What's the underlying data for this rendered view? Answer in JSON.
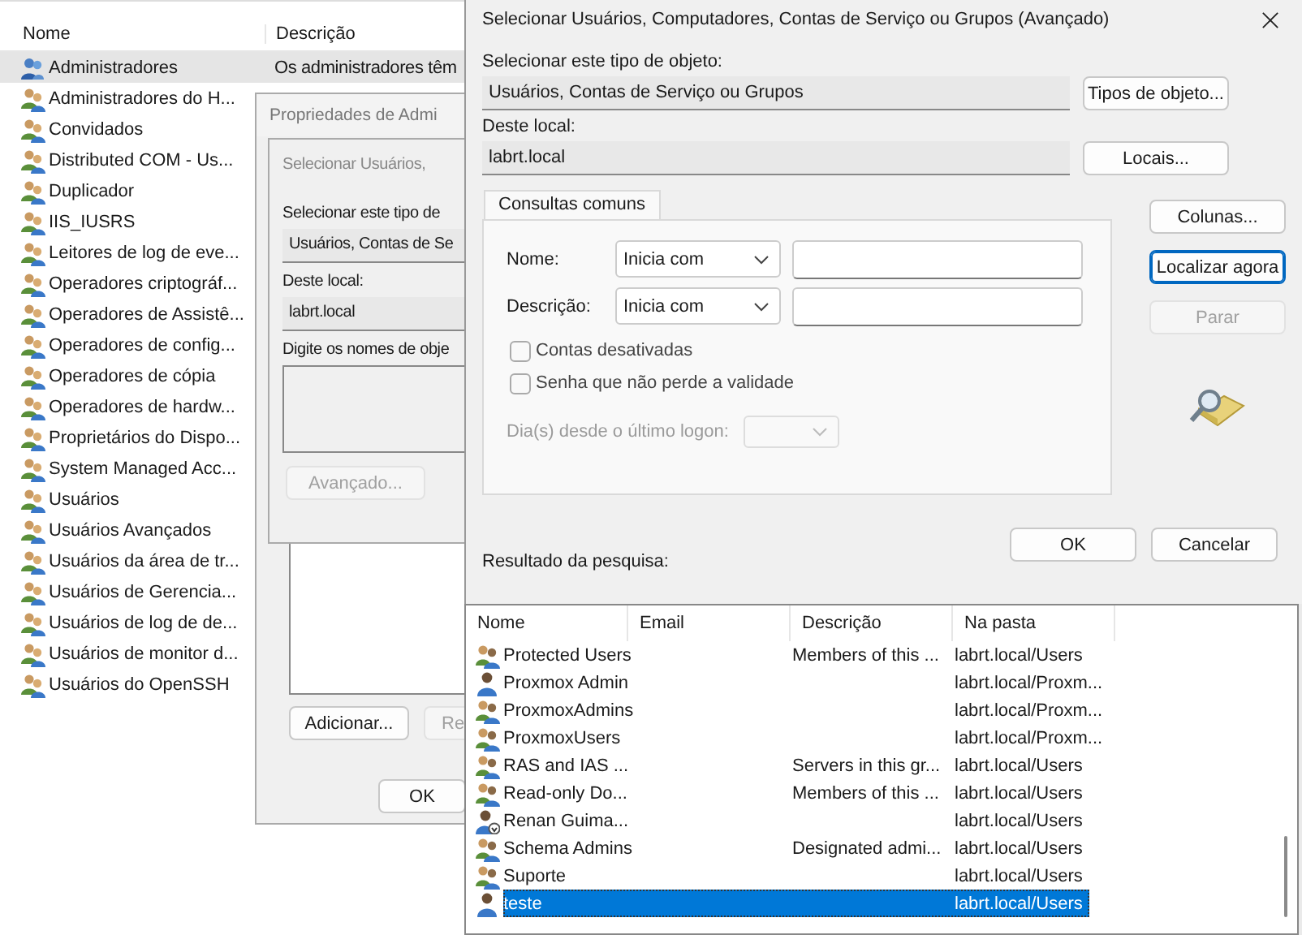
{
  "group_list": {
    "columns": [
      "Nome",
      "Descrição"
    ],
    "rows": [
      {
        "name": "Administradores",
        "description": "Os administradores têm",
        "kind": "special",
        "selected": true
      },
      {
        "name": "Administradores do H...",
        "kind": "group",
        "selected": false
      },
      {
        "name": "Convidados",
        "kind": "group",
        "selected": false
      },
      {
        "name": "Distributed COM - Us...",
        "kind": "group",
        "selected": false
      },
      {
        "name": "Duplicador",
        "kind": "group",
        "selected": false
      },
      {
        "name": "IIS_IUSRS",
        "kind": "group",
        "selected": false
      },
      {
        "name": "Leitores de log de eve...",
        "kind": "group",
        "selected": false
      },
      {
        "name": "Operadores criptográf...",
        "kind": "group",
        "selected": false
      },
      {
        "name": "Operadores de Assistê...",
        "kind": "group",
        "selected": false
      },
      {
        "name": "Operadores de config...",
        "kind": "group",
        "selected": false
      },
      {
        "name": "Operadores de cópia",
        "kind": "group",
        "selected": false
      },
      {
        "name": "Operadores de hardw...",
        "kind": "group",
        "selected": false
      },
      {
        "name": "Proprietários do Dispo...",
        "kind": "group",
        "selected": false
      },
      {
        "name": "System Managed Acc...",
        "kind": "group",
        "selected": false
      },
      {
        "name": "Usuários",
        "kind": "group",
        "selected": false
      },
      {
        "name": "Usuários Avançados",
        "kind": "group",
        "selected": false
      },
      {
        "name": "Usuários da área de tr...",
        "kind": "group",
        "selected": false
      },
      {
        "name": "Usuários de Gerencia...",
        "kind": "group",
        "selected": false
      },
      {
        "name": "Usuários de log de de...",
        "kind": "group",
        "selected": false
      },
      {
        "name": "Usuários de monitor d...",
        "kind": "group",
        "selected": false
      },
      {
        "name": "Usuários do OpenSSH",
        "kind": "group",
        "selected": false
      }
    ]
  },
  "properties_dialog": {
    "title": "Propriedades de Admi",
    "buttons": [
      {
        "label": "Adicionar...",
        "disabled": false
      },
      {
        "label": "Re",
        "disabled": true
      }
    ],
    "ok": "OK"
  },
  "inner_dialog": {
    "title": "Selecionar Usuários,",
    "type_label": "Selecionar este tipo de",
    "type_value": "Usuários, Contas de Se",
    "location_label": "Deste local:",
    "location_value": "labrt.local",
    "names_label": "Digite os nomes de obje",
    "advanced_button": {
      "label": "Avançado...",
      "disabled": true
    }
  },
  "advanced_dialog": {
    "title": "Selecionar Usuários, Computadores, Contas de Serviço ou Grupos (Avançado)",
    "type_label": "Selecionar este tipo de objeto:",
    "type_value": "Usuários, Contas de Serviço ou Grupos",
    "object_types_button": "Tipos de objeto...",
    "location_label": "Deste local:",
    "location_value": "labrt.local",
    "locations_button": "Locais...",
    "tabs": [
      {
        "label": "Consultas comuns",
        "selected": true
      }
    ],
    "queries": [
      {
        "label": "Nome:",
        "operator": "Inicia com"
      },
      {
        "label": "Descrição:",
        "operator": "Inicia com"
      }
    ],
    "checkboxes": [
      {
        "label": "Contas desativadas",
        "checked": false
      },
      {
        "label": "Senha que não perde a validade",
        "checked": false
      }
    ],
    "days": {
      "label": "Dia(s) desde o último logon:",
      "disabled": true
    },
    "side_buttons": [
      {
        "label": "Colunas...",
        "disabled": false,
        "focused": false
      },
      {
        "label": "Localizar agora",
        "disabled": false,
        "focused": true
      },
      {
        "label": "Parar",
        "disabled": true,
        "focused": false
      }
    ],
    "ok": "OK",
    "cancel": "Cancelar",
    "results_label": "Resultado da pesquisa:"
  },
  "results": {
    "columns": [
      "Nome",
      "Email",
      "Descrição",
      "Na pasta"
    ],
    "rows": [
      {
        "name": "Protected Users",
        "description": "Members of this ...",
        "folder": "labrt.local/Users",
        "kind": "group",
        "selected": false
      },
      {
        "name": "Proxmox Admin",
        "folder": "labrt.local/Proxm...",
        "kind": "user",
        "selected": false
      },
      {
        "name": "ProxmoxAdmins",
        "folder": "labrt.local/Proxm...",
        "kind": "group",
        "selected": false
      },
      {
        "name": "ProxmoxUsers",
        "folder": "labrt.local/Proxm...",
        "kind": "group",
        "selected": false
      },
      {
        "name": "RAS and IAS ...",
        "description": "Servers in this gr...",
        "folder": "labrt.local/Users",
        "kind": "group",
        "selected": false
      },
      {
        "name": "Read-only Do...",
        "description": "Members of this ...",
        "folder": "labrt.local/Users",
        "kind": "group",
        "selected": false
      },
      {
        "name": "Renan Guima...",
        "folder": "labrt.local/Users",
        "kind": "disabled-user",
        "selected": false
      },
      {
        "name": "Schema Admins",
        "description": "Designated admi...",
        "folder": "labrt.local/Users",
        "kind": "group",
        "selected": false
      },
      {
        "name": "Suporte",
        "folder": "labrt.local/Users",
        "kind": "group",
        "selected": false
      },
      {
        "name": "teste",
        "folder": "labrt.local/Users",
        "kind": "user",
        "selected": true
      }
    ]
  }
}
